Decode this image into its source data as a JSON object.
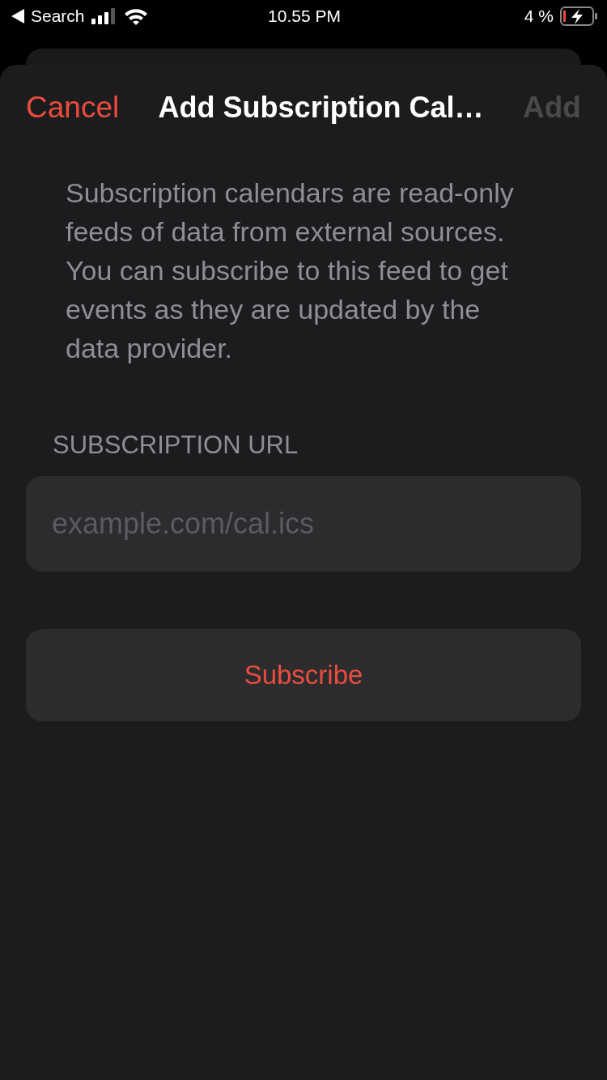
{
  "status_bar": {
    "back_label": "Search",
    "time": "10.55 PM",
    "battery": "4 %"
  },
  "nav": {
    "cancel": "Cancel",
    "title": "Add Subscription Cal…",
    "add": {
      "label": "Add",
      "disabled": true
    }
  },
  "description": "Subscription calendars are read-only feeds of data from external sources. You can subscribe to this feed to get events as they are updated by the data provider.",
  "section_header": "SUBSCRIPTION URL",
  "url_field": {
    "placeholder": "example.com/cal.ics"
  },
  "subscribe_button": "Subscribe"
}
